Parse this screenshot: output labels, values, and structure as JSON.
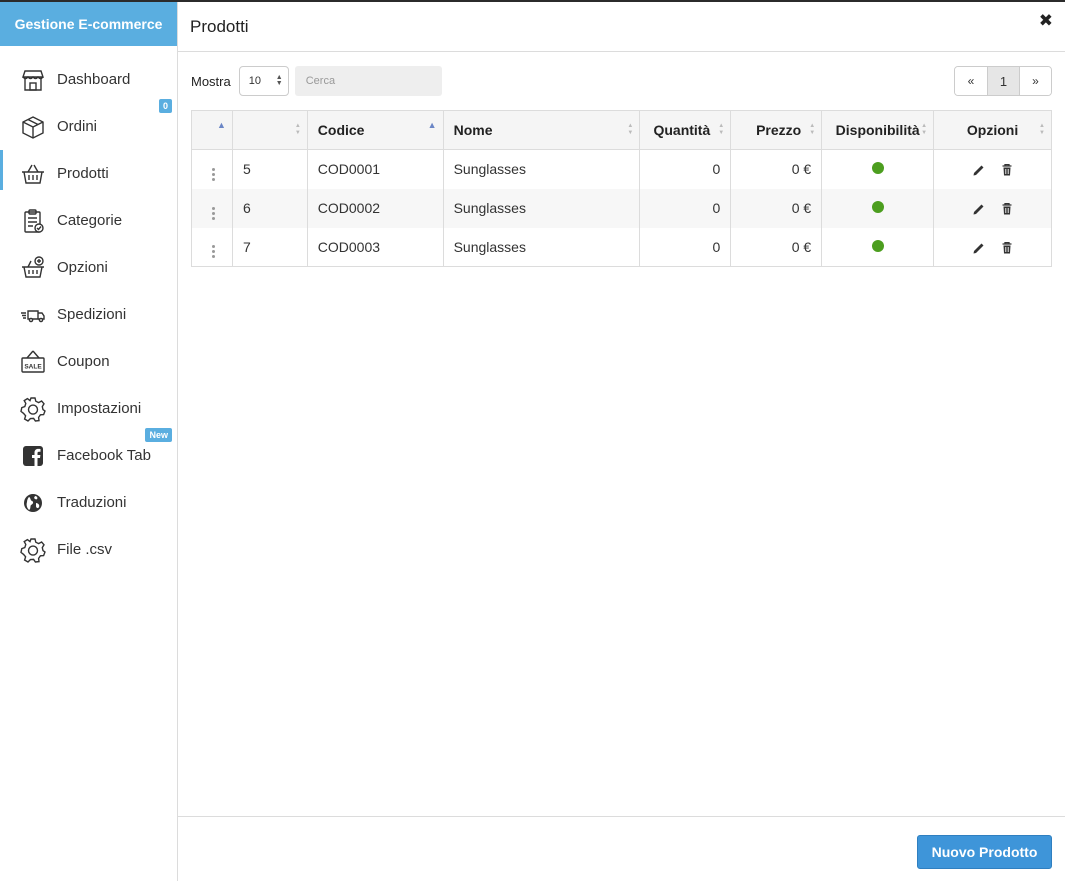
{
  "app": {
    "brand": "Gestione E-commerce"
  },
  "sidebar": {
    "items": [
      {
        "label": "Dashboard",
        "icon": "storefront-icon"
      },
      {
        "label": "Ordini",
        "icon": "box-icon",
        "badge": "0"
      },
      {
        "label": "Prodotti",
        "icon": "basket-icon",
        "active": true
      },
      {
        "label": "Categorie",
        "icon": "clipboard-icon"
      },
      {
        "label": "Opzioni",
        "icon": "basket-plus-icon"
      },
      {
        "label": "Spedizioni",
        "icon": "truck-icon"
      },
      {
        "label": "Coupon",
        "icon": "sale-sign-icon"
      },
      {
        "label": "Impostazioni",
        "icon": "gear-icon"
      },
      {
        "label": "Facebook Tab",
        "icon": "facebook-icon",
        "badge": "New"
      },
      {
        "label": "Traduzioni",
        "icon": "globe-icon"
      },
      {
        "label": "File .csv",
        "icon": "gear-icon"
      }
    ]
  },
  "header": {
    "title": "Prodotti",
    "close_icon": "close-icon"
  },
  "toolbar": {
    "show_label": "Mostra",
    "page_size": "10",
    "search_placeholder": "Cerca"
  },
  "pagination": {
    "prev": "«",
    "current": "1",
    "next": "»"
  },
  "table": {
    "columns": [
      "",
      "",
      "Codice",
      "Nome",
      "Quantità",
      "Prezzo",
      "Disponibilità",
      "Opzioni"
    ],
    "rows": [
      {
        "id": "5",
        "code": "COD0001",
        "name": "Sunglasses",
        "quantity": "0",
        "price": "0 €",
        "available": true
      },
      {
        "id": "6",
        "code": "COD0002",
        "name": "Sunglasses",
        "quantity": "0",
        "price": "0 €",
        "available": true
      },
      {
        "id": "7",
        "code": "COD0003",
        "name": "Sunglasses",
        "quantity": "0",
        "price": "0 €",
        "available": true
      }
    ]
  },
  "footer": {
    "new_product_label": "Nuovo Prodotto"
  },
  "colors": {
    "accent": "#5aaee0",
    "button": "#3e95d9",
    "available": "#4c9e1f"
  }
}
